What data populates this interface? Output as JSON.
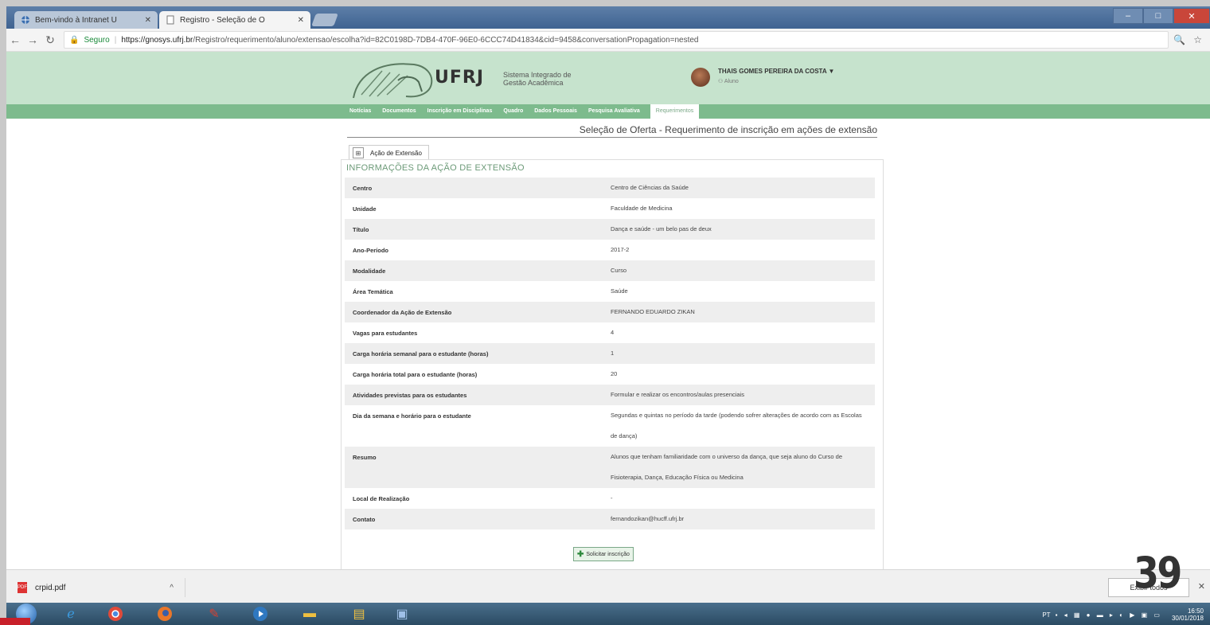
{
  "browser": {
    "tabs": [
      {
        "label": "Bem-vindo à Intranet U"
      },
      {
        "label": "Registro - Seleção de O"
      }
    ],
    "secure_label": "Seguro",
    "url_host": "https://gnosys.ufrj.br",
    "url_path": "/Registro/requerimento/aluno/extensao/escolha?id=82C0198D-7DB4-470F-96E0-6CCC74D41834&cid=9458&conversationPropagation=nested"
  },
  "header": {
    "logo_text": "UFRJ",
    "logo_subtitle": "Sistema Integrado de Gestão Acadêmica",
    "user_name": "THAIS GOMES PEREIRA DA COSTA",
    "user_role": "Aluno"
  },
  "menu": {
    "items": [
      {
        "label": "Notícias"
      },
      {
        "label": "Documentos"
      },
      {
        "label": "Inscrição em Disciplinas"
      },
      {
        "label": "Quadro"
      },
      {
        "label": "Dados Pessoais"
      },
      {
        "label": "Pesquisa Avaliativa"
      },
      {
        "label": "Requerimentos"
      }
    ]
  },
  "content": {
    "page_title": "Seleção de Oferta - Requerimento de inscrição em ações de extensão",
    "panel_tab": "Ação de Extensão",
    "section_title": "INFORMAÇÕES DA AÇÃO DE EXTENSÃO",
    "rows": [
      {
        "label": "Centro",
        "value": "Centro de Ciências da Saúde"
      },
      {
        "label": "Unidade",
        "value": "Faculdade de Medicina"
      },
      {
        "label": "Título",
        "value": "Dança e saúde - um belo pas de deux"
      },
      {
        "label": "Ano-Período",
        "value": "2017-2"
      },
      {
        "label": "Modalidade",
        "value": "Curso"
      },
      {
        "label": "Área Temática",
        "value": "Saúde"
      },
      {
        "label": "Coordenador da Ação de Extensão",
        "value": "FERNANDO EDUARDO ZIKAN"
      },
      {
        "label": "Vagas para estudantes",
        "value": "4"
      },
      {
        "label": "Carga horária semanal para o estudante (horas)",
        "value": "1"
      },
      {
        "label": "Carga horária total para o estudante (horas)",
        "value": "20"
      },
      {
        "label": "Atividades previstas para os estudantes",
        "value": "Formular e realizar os encontros/aulas presenciais"
      },
      {
        "label": "Dia da semana e horário para o estudante",
        "value": "Segundas e quintas no período da tarde (podendo sofrer alterações de acordo com as Escolas de dança)"
      },
      {
        "label": "Resumo",
        "value": "Alunos que tenham familiaridade com o universo da dança, que seja aluno do Curso de Fisioterapia, Dança, Educação Física ou Medicina"
      },
      {
        "label": "Local de Realização",
        "value": "-"
      },
      {
        "label": "Contato",
        "value": "fernandozikan@hucff.ufrj.br"
      }
    ],
    "submit_label": "Solicitar inscrição"
  },
  "downloads": {
    "file_name": "crpid.pdf",
    "show_all_label": "Exibir todos"
  },
  "taskbar": {
    "time": "16:50",
    "date": "30/01/2018",
    "lang": "PT"
  },
  "slide": {
    "number": "39"
  }
}
